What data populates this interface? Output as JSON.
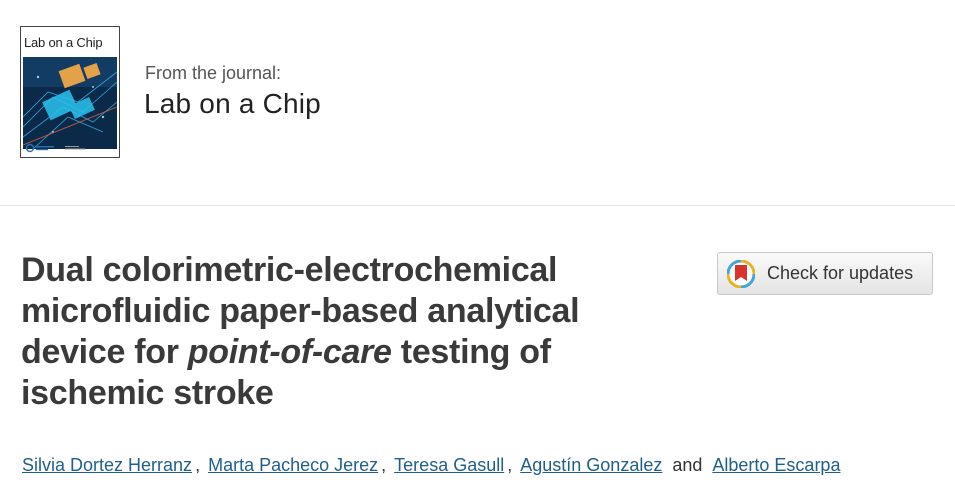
{
  "journal": {
    "cover_title": "Lab on a Chip",
    "from_label": "From the journal:",
    "name": "Lab on a Chip"
  },
  "article": {
    "title_part1": "Dual colorimetric-electrochemical microfluidic paper-based analytical device for ",
    "title_italic": "point-of-care",
    "title_part2": " testing of ischemic stroke"
  },
  "check_updates": {
    "label": "Check for updates",
    "icon": "crossmark-icon"
  },
  "authors": {
    "names": [
      "Silvia Dortez Herranz",
      "Marta Pacheco Jerez",
      "Teresa Gasull",
      "Agustín Gonzalez",
      "Alberto Escarpa"
    ],
    "separator": ",",
    "conjunction": "and"
  },
  "colors": {
    "link": "#1f5f8b",
    "title": "#3a3a3a",
    "divider": "#e6e6e6"
  }
}
